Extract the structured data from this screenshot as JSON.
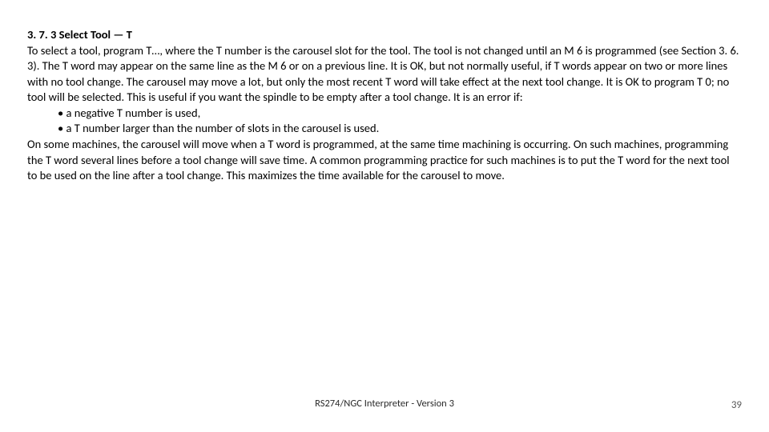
{
  "heading": "3. 7. 3 Select Tool — T",
  "para1": "To select a tool, program T…, where the T number is the carousel slot for the tool. The tool is not changed until an M 6 is programmed (see Section 3. 6. 3). The T word may appear on the same line as the M 6 or on a previous line. It is OK, but not normally useful, if T words appear on two or more lines with no tool change. The carousel may move a lot, but only the most recent T word will take effect at the next tool change. It is OK to program T 0; no tool will be selected. This is useful if you want the spindle to be empty after a tool change. It is an error if:",
  "bullets": [
    "• a negative T number is used,",
    "• a T number larger than the number of slots in the carousel is used."
  ],
  "para2": "On some machines, the carousel will move when a T word is programmed, at the same time machining is occurring. On such machines, programming the T word several lines before a tool change will save time. A common programming practice for such machines is to put the T word for the next tool to be used on the line after a tool change. This maximizes the time available for the carousel to move.",
  "footer_center": "RS274/NGC Interpreter - Version 3",
  "footer_right": "39"
}
